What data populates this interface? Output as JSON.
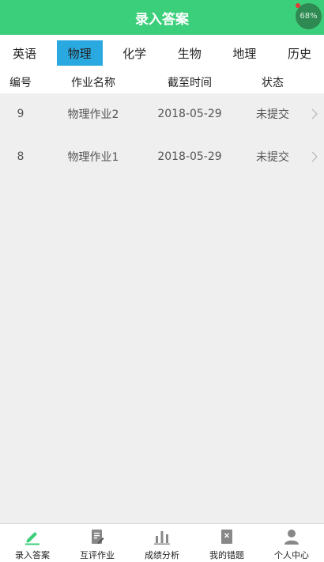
{
  "header": {
    "title": "录入答案",
    "badge": "68%"
  },
  "subjects": [
    {
      "label": "英语",
      "active": false
    },
    {
      "label": "物理",
      "active": true
    },
    {
      "label": "化学",
      "active": false
    },
    {
      "label": "生物",
      "active": false
    },
    {
      "label": "地理",
      "active": false
    },
    {
      "label": "历史",
      "active": false
    }
  ],
  "table": {
    "columns": [
      "编号",
      "作业名称",
      "截至时间",
      "状态"
    ],
    "rows": [
      {
        "id": "9",
        "name": "物理作业2",
        "deadline": "2018-05-29",
        "status": "未提交"
      },
      {
        "id": "8",
        "name": "物理作业1",
        "deadline": "2018-05-29",
        "status": "未提交"
      }
    ]
  },
  "nav": [
    {
      "label": "录入答案",
      "icon": "pencil-icon",
      "active": true
    },
    {
      "label": "互评作业",
      "icon": "document-edit-icon",
      "active": false
    },
    {
      "label": "成绩分析",
      "icon": "bar-chart-icon",
      "active": false
    },
    {
      "label": "我的错题",
      "icon": "wrong-book-icon",
      "active": false
    },
    {
      "label": "个人中心",
      "icon": "person-icon",
      "active": false
    }
  ],
  "colors": {
    "header": "#3ccf7b",
    "activeTab": "#2aa8e0",
    "activeNav": "#3ccf7b",
    "inactiveNav": "#888888"
  }
}
